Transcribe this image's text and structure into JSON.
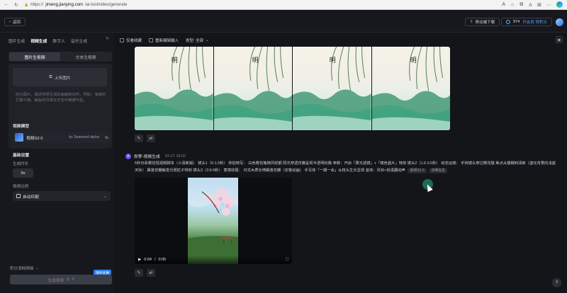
{
  "browser": {
    "url_prefix": "https://",
    "url_host": "jimeng.jianying.com",
    "url_path": "/ai-tool/video/generate"
  },
  "header": {
    "back_label": "返回",
    "mobile_download_label": "移动端下载",
    "credits_value": "974",
    "vip_label": "开会员 得积分"
  },
  "left_panel": {
    "tabs": [
      {
        "label": "图片生成"
      },
      {
        "label": "视频生成"
      },
      {
        "label": "数字人"
      },
      {
        "label": "音乐生成"
      }
    ],
    "mode_options": [
      {
        "label": "图片生视频"
      },
      {
        "label": "文本生视频"
      }
    ],
    "upload_label": "上传图片",
    "description": "结合图片，描述你想生成的画面和动作。例如：海底的打着汐潮，鲸鱼的月亮在天空中缓缓升起。",
    "model_section_label": "视频模型",
    "model_name": "视频S2.0",
    "model_by": "by Seaweed alpha",
    "basic_settings_label": "基础设置",
    "duration_label": "生成时长",
    "duration_value": "5s",
    "ratio_label": "视频比例",
    "ratio_value": "自动匹配",
    "points_detail_label": "积分消耗明细",
    "generate_label": "生成视频",
    "generate_cost": "5",
    "limited_badge": "限时优惠"
  },
  "main": {
    "filters": {
      "favorites_label": "仅看收藏",
      "reedit_label": "重新编辑输入",
      "type_label": "类型: 全部"
    },
    "task": {
      "title": "即梦-视频生成",
      "time": "03-27  18:02",
      "prompt": "5秒日系樱花短视频脚本（小清新版） 镜头1（0-1.5秒） 仰拍特写： 白色樱花簇随风轻颤 阳光穿透花瓣呈现半透明纹路 参数：开启「柔光滤镜」+「镜色蓝片」特效 镜头2（1.6-3.5秒） 动态运镜： 手持镜头穿过樱花隧 焦点从模糊到清晰（虚化背景的浅蓝天际） 飘落花瓣触发光斑粒子特效 镜头3（3.6-5秒） 意境收尾： 日式木质长椅飘落花瓣（定格动画） 手写体「一期一会」从枝头生长显现 音效：风铃+低语翻动声",
      "tag_model": "视频S2.0",
      "tag_detail": "详细信息"
    },
    "video": {
      "current_time": "0:04",
      "separator": "/",
      "duration": "0:05"
    }
  },
  "colors": {
    "accent_blue": "#4ea3ff",
    "task_icon": "#6a55e8",
    "cursor_highlight": "#1f6a55"
  }
}
